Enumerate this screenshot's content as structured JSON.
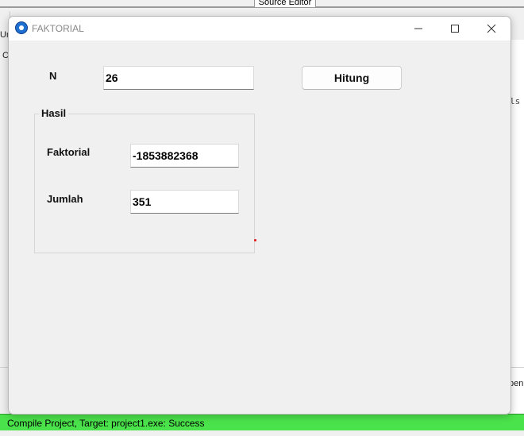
{
  "ide": {
    "source_editor_tab": "Source Editor",
    "left_fragment_1": "Ur",
    "left_fragment_2": "C",
    "right_fragment_1": "ls",
    "right_fragment_2": "pen",
    "status_text": "Compile Project, Target: project1.exe: Success",
    "status_color": "#4be34b"
  },
  "window": {
    "title": "FAKTORIAL",
    "controls": [
      "minimize-icon",
      "maximize-icon",
      "close-icon"
    ]
  },
  "form": {
    "n_label": "N",
    "n_value": "26",
    "button_label": "Hitung",
    "group_caption": "Hasil",
    "faktorial_label": "Faktorial",
    "faktorial_value": "-1853882368",
    "jumlah_label": "Jumlah",
    "jumlah_value": "351"
  }
}
